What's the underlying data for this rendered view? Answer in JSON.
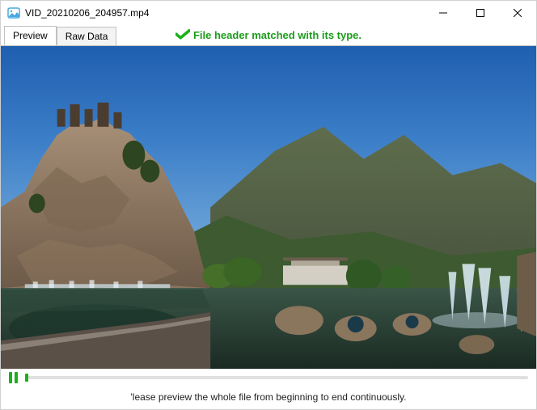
{
  "window": {
    "title": "VID_20210206_204957.mp4"
  },
  "tabs": {
    "preview": "Preview",
    "raw_data": "Raw Data"
  },
  "status": {
    "message": "File header matched with its type."
  },
  "footer": {
    "hint": "'lease preview the whole file from beginning to end continuously."
  }
}
